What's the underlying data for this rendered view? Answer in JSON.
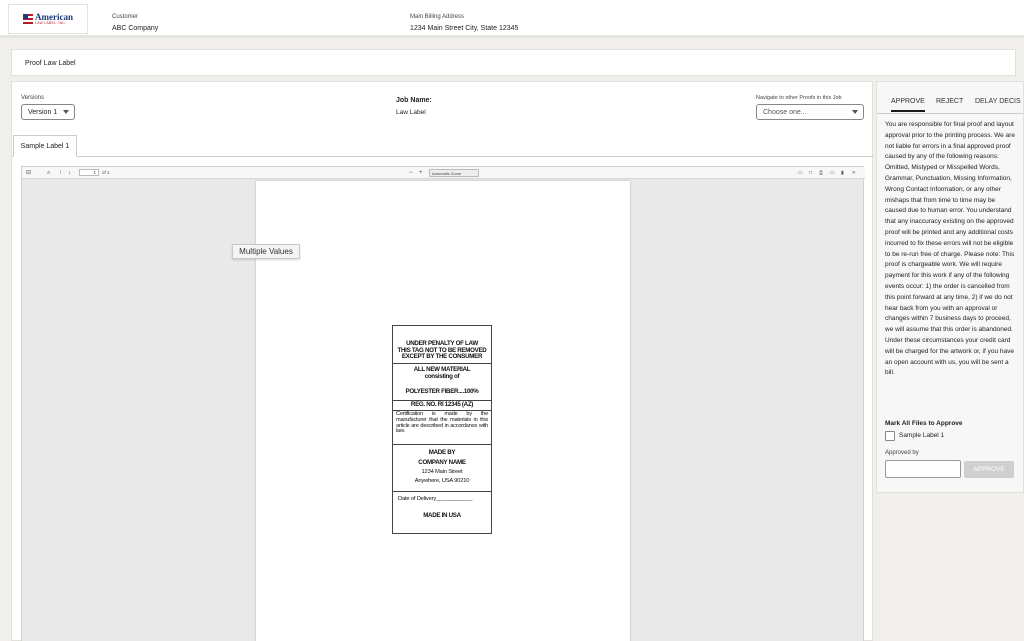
{
  "header": {
    "logo": {
      "name": "American",
      "tagline": "LAW LABEL, INC."
    },
    "customer_label": "Customer",
    "customer_value": "ABC Company",
    "billing_label": "Main Billing Address",
    "billing_value": "1234 Main Street City, State 12345"
  },
  "page_title": "Proof Law Label",
  "controls": {
    "versions_label": "Versions",
    "version_selected": "Version 1",
    "job_name_label": "Job Name:",
    "job_name_value": "Law Label",
    "navigate_label": "Navigate to other Proofs in this Job",
    "navigate_placeholder": "Choose one..."
  },
  "tabs": [
    {
      "label": "Sample Label 1"
    }
  ],
  "viewer": {
    "page_number": "1",
    "page_count": "of 1",
    "zoom": "Automatic Zoom",
    "tooltip": "Multiple Values"
  },
  "law_label": {
    "warning_1": "UNDER PENALTY OF LAW",
    "warning_2": "THIS TAG NOT TO BE REMOVED",
    "warning_3": "EXCEPT BY THE CONSUMER",
    "material_1": "ALL NEW MATERIAL",
    "material_2": "consisting of",
    "fiber": "POLYESTER FIBER....100%",
    "reg_no": "REG. NO. RI 12345 (AZ)",
    "certification": "Certification is made by the manufacturer that the materials in this article are described in accordance with law.",
    "made_by": "MADE BY",
    "company": "COMPANY NAME",
    "street": "1234 Main Street",
    "city": "Anywhere, USA 90210",
    "date_of_delivery": "Date of Delivery____________",
    "origin": "MADE IN USA"
  },
  "approval": {
    "tabs": [
      "APPROVE",
      "REJECT",
      "DELAY DECIS"
    ],
    "terms": "You are responsible for final proof and layout approval prior to the printing process. We are not liable for errors in a final approved proof caused by any of the following reasons: Omitted, Mistyped or Misspelled Words, Grammar, Punctuation, Missing Information, Wrong Contact Information, or any other mishaps that from time to time may be caused due to human error. You understand that any inaccuracy existing on the approved proof will be printed and any additional costs incurred to fix these errors will not be eligible to be re-run free of charge. Please note: This proof is chargeable work. We will require payment for this work if any of the following events occur: 1) the order is cancelled from this point forward at any time, 2) if we do not hear back from you with an approval or changes within 7 business days to proceed, we will assume that this order is abandoned. Under these circumstances your credit card will be charged for the artwork or, if you have an open account with us, you will be sent a bill.",
    "mark_all_label": "Mark All Files to Approve",
    "file_checkbox_label": "Sample Label 1",
    "approved_by_label": "Approved by",
    "approve_button": "APPROVE"
  }
}
